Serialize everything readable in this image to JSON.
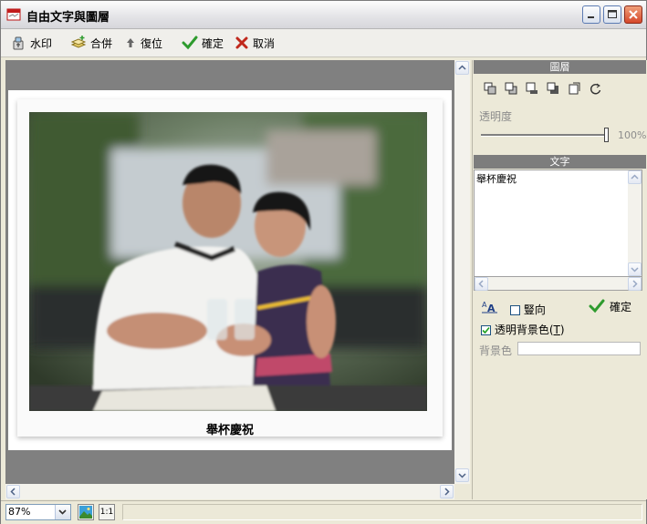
{
  "window": {
    "title": "自由文字與圖層"
  },
  "toolbar": {
    "watermark_label": "水印",
    "merge_label": "合併",
    "restore_label": "復位",
    "ok_label": "確定",
    "cancel_label": "取消"
  },
  "canvas": {
    "caption": "舉杯慶祝"
  },
  "layer_panel": {
    "header": "圖層",
    "opacity_label": "透明度",
    "opacity_value": "100%",
    "opacity_fraction": 1.0
  },
  "text_panel": {
    "header": "文字",
    "text_value": "舉杯慶祝",
    "vertical_label": "豎向",
    "vertical_checked": false,
    "ok_label": "確定",
    "transparent_bg_label": "透明背景色(",
    "transparent_bg_hotkey": "T",
    "transparent_bg_close": ")",
    "transparent_bg_checked": true,
    "bg_color_label": "背景色"
  },
  "statusbar": {
    "zoom_value": "87%",
    "actual_size_label": "1:1"
  },
  "colors": {
    "accent_ok": "#2e9b2e",
    "cancel_red": "#c0281c",
    "canvas_gray": "#808080",
    "panel_header": "#7d7d7d"
  }
}
